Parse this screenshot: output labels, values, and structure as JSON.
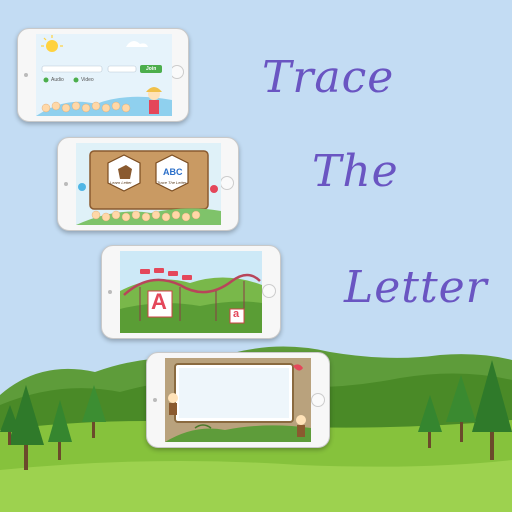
{
  "title": {
    "line1": "Trace",
    "line2": "The",
    "line3": "Letter"
  },
  "screen1": {
    "media_options": [
      "Audio",
      "Video"
    ],
    "join_button": "Join"
  },
  "screen2": {
    "cards": [
      {
        "icon": "horse-icon",
        "label": "Learn Letter"
      },
      {
        "icon": "abc-icon",
        "label": "Trace The Letter"
      }
    ]
  },
  "screen3": {
    "letter_big": "A",
    "letter_small": "a"
  },
  "colors": {
    "sky": "#c3dcf3",
    "title": "#6a55c2",
    "hills": "#4f8f2a",
    "grass": "#8cc63f"
  }
}
